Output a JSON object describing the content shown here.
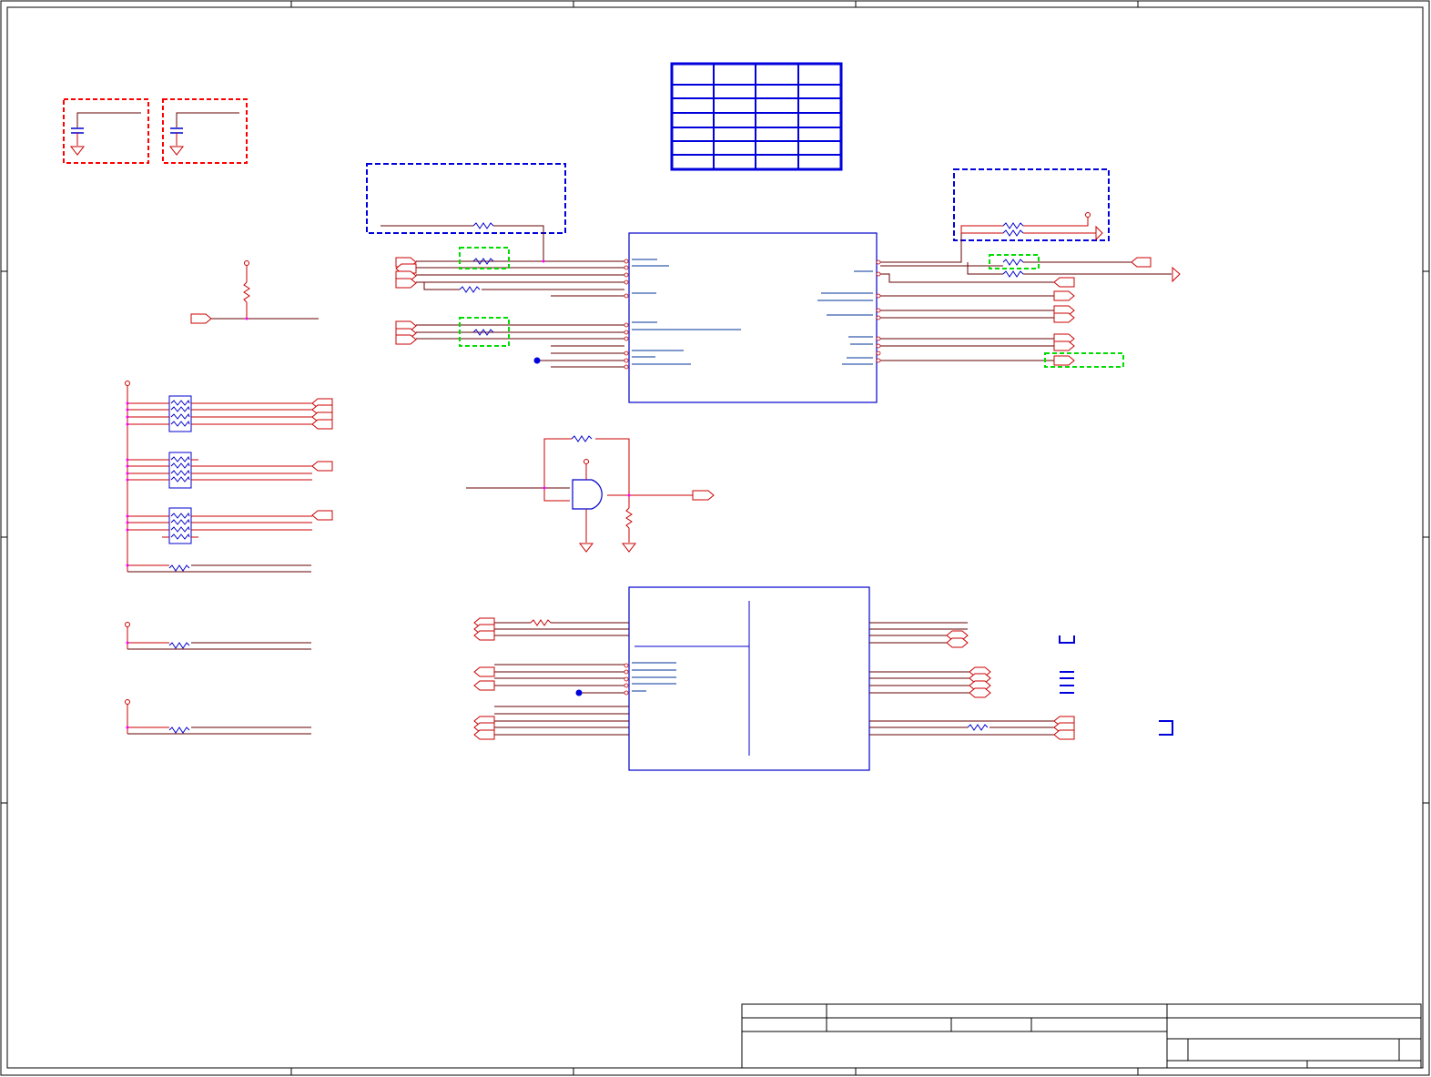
{
  "sheet": {
    "colors": {
      "frame": "#000000",
      "wire": "#cc0000",
      "wire_dark": "#660000",
      "component": "#0000cc",
      "junction": "#ff00ff",
      "highlight_red": "#ff0000",
      "highlight_blue": "#0000dd",
      "highlight_green": "#00dd00",
      "bus_blue": "#003399"
    },
    "components": [
      "decoupling-capacitor",
      "ground-symbol",
      "resistor",
      "resistor-network",
      "and-gate",
      "ic-block",
      "off-page-connector",
      "power-pin",
      "junction-dot",
      "title-block"
    ]
  }
}
